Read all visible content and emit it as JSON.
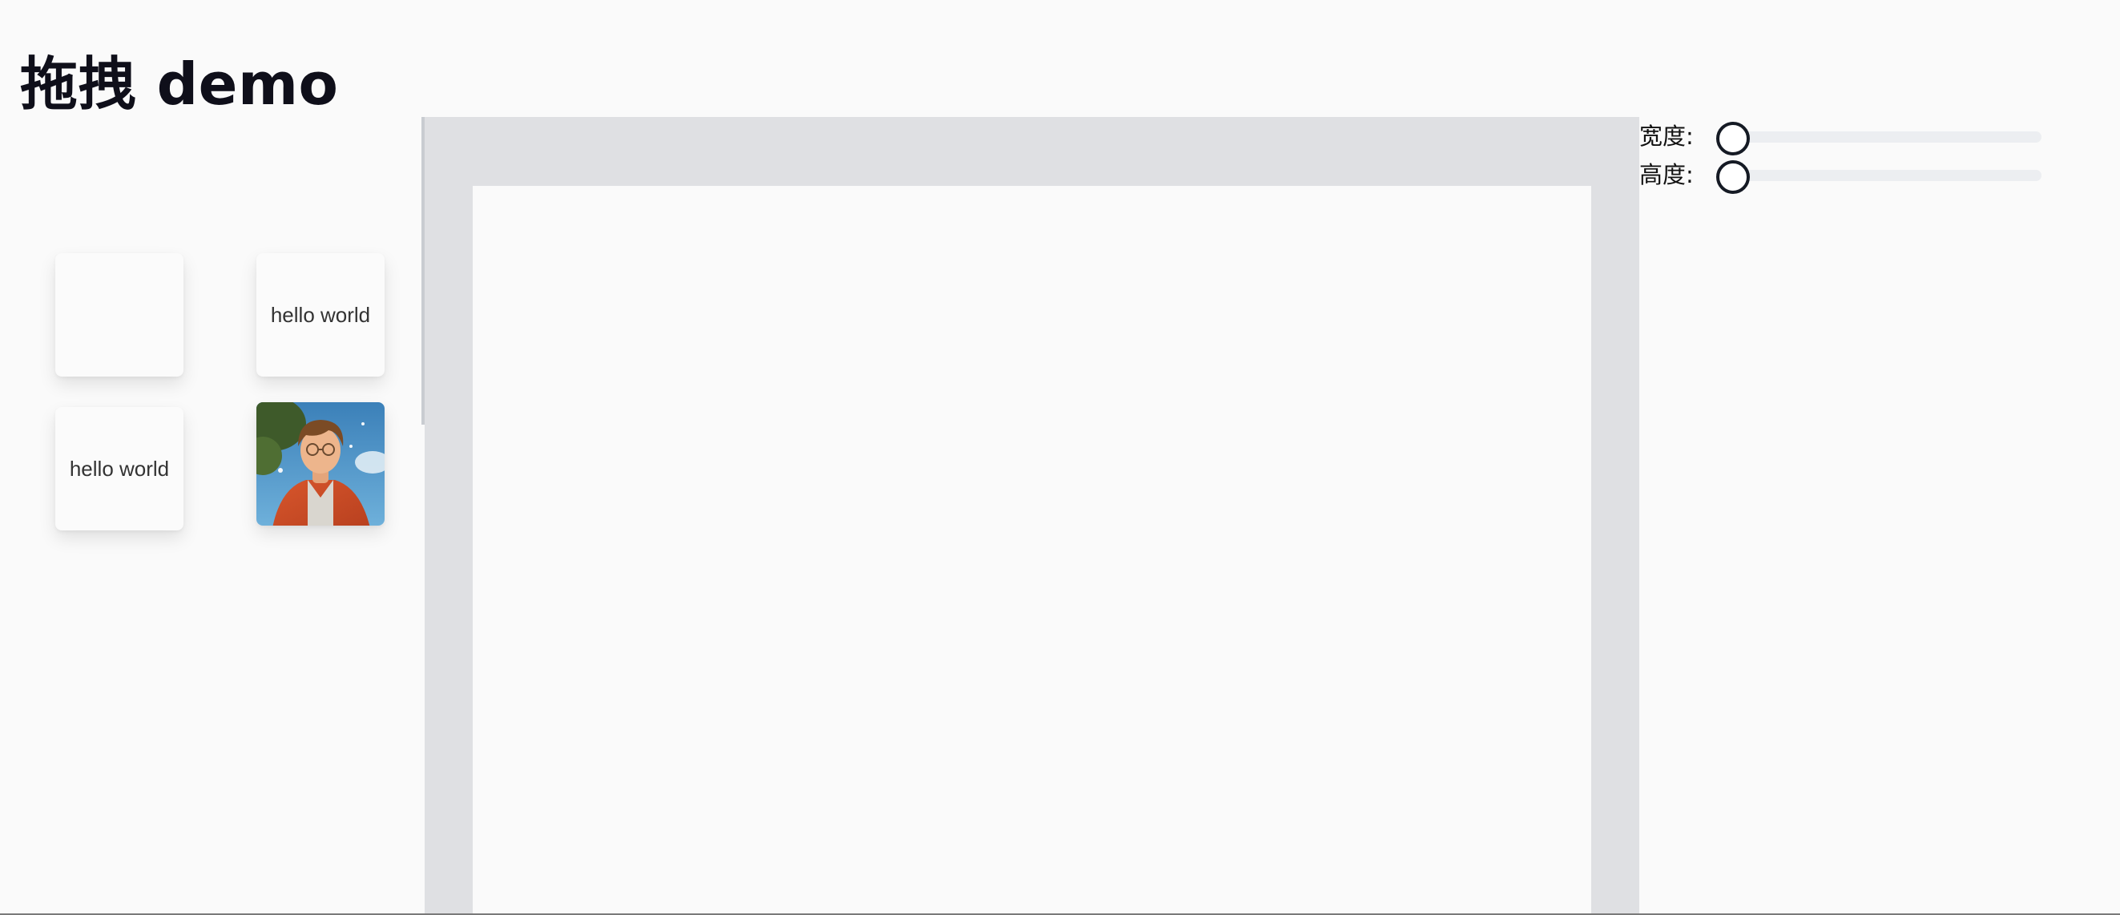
{
  "page": {
    "title": "拖拽 demo"
  },
  "palette": {
    "items": [
      {
        "type": "blank",
        "label": ""
      },
      {
        "type": "text",
        "label": "hello world"
      },
      {
        "type": "text",
        "label": "hello world"
      },
      {
        "type": "image",
        "label": ""
      }
    ]
  },
  "properties": {
    "width": {
      "label": "宽度:",
      "value": 0
    },
    "height": {
      "label": "高度:",
      "value": 0
    }
  },
  "colors": {
    "canvas_bg": "#dfe0e3",
    "slider_track": "#eceef1",
    "slider_thumb_border": "#151a24"
  }
}
